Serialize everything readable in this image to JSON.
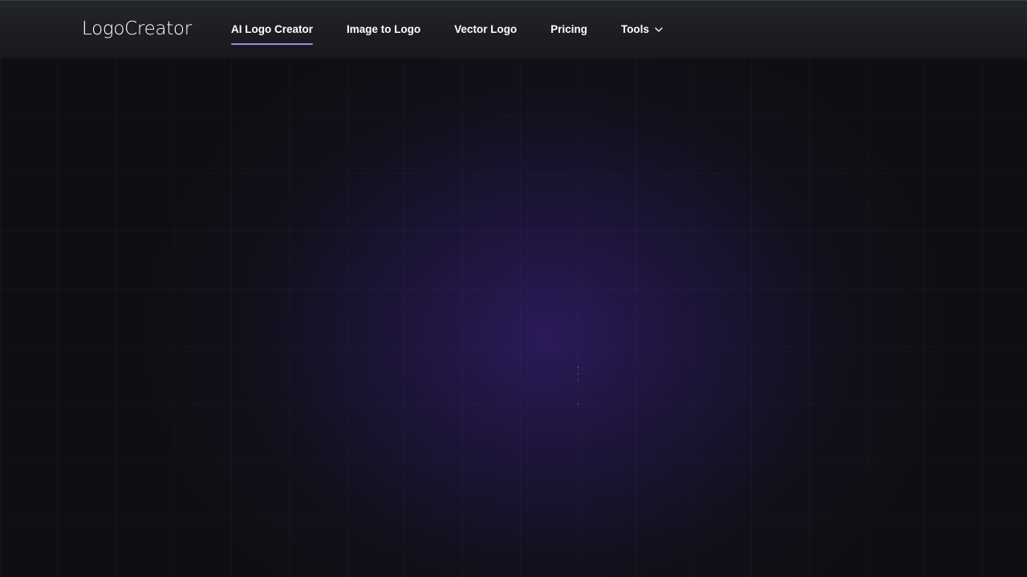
{
  "header": {
    "logo_text": "LogoCreator",
    "nav": [
      {
        "label": "AI Logo Creator",
        "active": true
      },
      {
        "label": "Image to Logo",
        "active": false
      },
      {
        "label": "Vector Logo",
        "active": false
      },
      {
        "label": "Pricing",
        "active": false
      },
      {
        "label": "Tools",
        "active": false,
        "icon": "chevron-down-icon"
      }
    ]
  },
  "colors": {
    "nav_active_underline": "#9a8ce0",
    "background": "#0e0f13",
    "glow": "#2c1a5c"
  }
}
